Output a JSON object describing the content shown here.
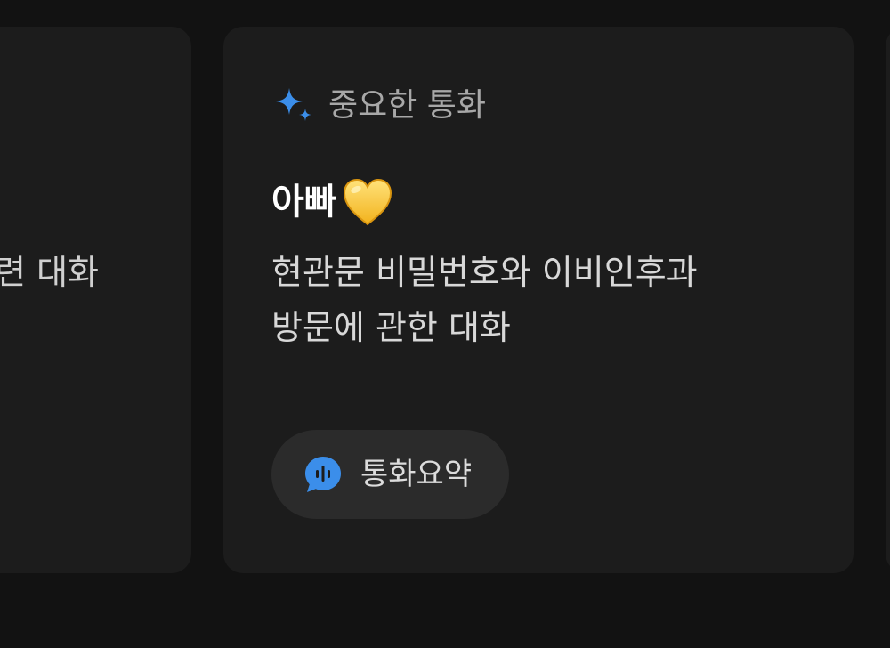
{
  "left_card": {
    "partial_text": "련 대화"
  },
  "main_card": {
    "label": "중요한 통화",
    "contact_name": "아빠",
    "contact_emoji_icon": "yellow-heart-icon",
    "summary_lines": [
      "현관문 비밀번호와 이비인후과",
      "방문에 관한 대화"
    ],
    "summary_button_label": "통화요약",
    "colors": {
      "accent": "#3b8eea",
      "card_bg": "#1c1c1c",
      "page_bg": "#121212",
      "chip_bg": "#2b2b2b"
    }
  }
}
